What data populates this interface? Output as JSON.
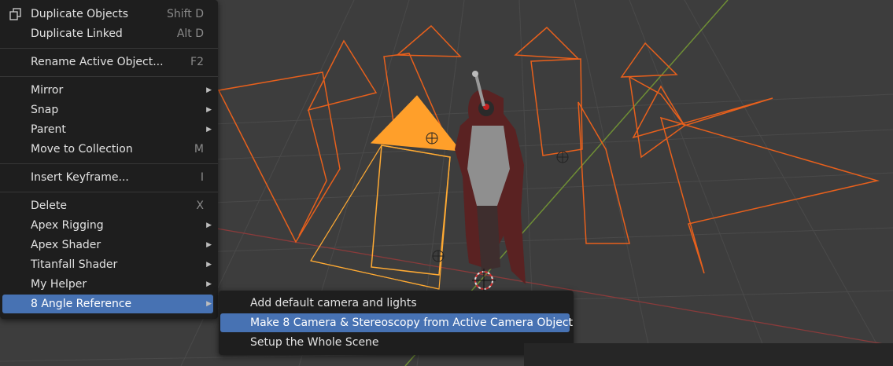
{
  "object_menu": {
    "items": [
      {
        "label": "Duplicate Objects",
        "shortcut": "Shift D",
        "icon": "duplicate-icon"
      },
      {
        "label": "Duplicate Linked",
        "shortcut": "Alt D"
      },
      {
        "label": "Rename Active Object...",
        "shortcut": "F2"
      },
      {
        "label": "Mirror",
        "submenu": true
      },
      {
        "label": "Snap",
        "submenu": true
      },
      {
        "label": "Parent",
        "submenu": true
      },
      {
        "label": "Move to Collection",
        "shortcut": "M"
      },
      {
        "label": "Insert Keyframe...",
        "shortcut": "I"
      },
      {
        "label": "Delete",
        "shortcut": "X"
      },
      {
        "label": "Apex Rigging",
        "submenu": true
      },
      {
        "label": "Apex Shader",
        "submenu": true
      },
      {
        "label": "Titanfall Shader",
        "submenu": true
      },
      {
        "label": "My Helper",
        "submenu": true
      },
      {
        "label": "8 Angle Reference",
        "submenu": true,
        "active": true
      }
    ],
    "submenu_arrow": "▶"
  },
  "angle_reference_submenu": {
    "items": [
      {
        "label": "Add default camera and lights"
      },
      {
        "label": "Make 8 Camera & Stereoscopy from Active Camera Object",
        "active": true
      },
      {
        "label": "Setup the Whole Scene"
      }
    ]
  },
  "colors": {
    "menu_bg": "#1e1e1e",
    "highlight": "#4772b3",
    "camera_wire": "#e8601c",
    "active_camera": "#ff9f2a",
    "viewport_bg": "#3d3d3d"
  }
}
